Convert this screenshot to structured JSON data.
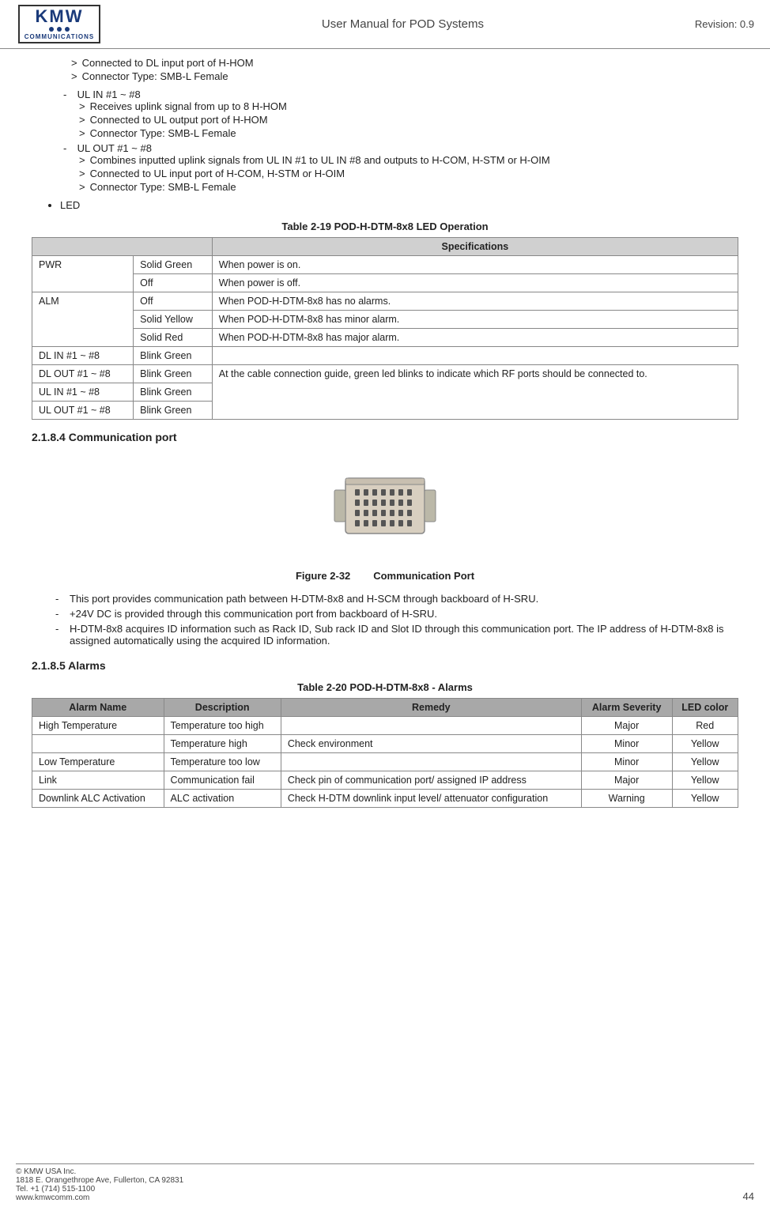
{
  "header": {
    "logo_letters": "KMW",
    "logo_comm": "COMMUNICATIONS",
    "title": "User Manual for POD Systems",
    "revision": "Revision: 0.9"
  },
  "bullets_top": {
    "items": [
      {
        "type": "sub",
        "text": "Connected to DL input port of H-HOM"
      },
      {
        "type": "sub",
        "text": "Connector Type: SMB-L Female"
      }
    ]
  },
  "dash_sections": [
    {
      "label": "UL IN #1 ~ #8",
      "subs": [
        "Receives uplink signal from up to 8 H-HOM",
        "Connected to UL output port of H-HOM",
        "Connector Type: SMB-L Female"
      ]
    },
    {
      "label": "UL OUT #1 ~ #8",
      "subs": [
        "Combines inputted uplink signals from UL IN #1 to UL IN #8 and outputs to H-COM, H-STM or H-OIM",
        "Connected to UL input port of H-COM, H-STM or H-OIM",
        "Connector Type: SMB-L Female"
      ]
    }
  ],
  "led_bullet": "LED",
  "table_led": {
    "title": "Table 2-19    POD-H-DTM-8x8 LED Operation",
    "col_header": "Specifications",
    "rows": [
      {
        "name": "PWR",
        "col2": "Solid Green",
        "col3": "When power is on."
      },
      {
        "name": "",
        "col2": "Off",
        "col3": "When power is off."
      },
      {
        "name": "ALM",
        "col2": "Off",
        "col3": "When POD-H-DTM-8x8 has no alarms."
      },
      {
        "name": "",
        "col2": "Solid Yellow",
        "col3": "When POD-H-DTM-8x8 has minor alarm."
      },
      {
        "name": "",
        "col2": "Solid Red",
        "col3": "When POD-H-DTM-8x8 has major alarm."
      },
      {
        "name": "DL IN #1 ~ #8",
        "col2": "Blink Green",
        "col3": ""
      },
      {
        "name": "DL OUT #1 ~ #8",
        "col2": "Blink Green",
        "col3": "At the cable connection guide, green led blinks to indicate which RF ports should be connected to."
      },
      {
        "name": "UL IN #1 ~ #8",
        "col2": "Blink Green",
        "col3": ""
      },
      {
        "name": "UL OUT #1 ~ #8",
        "col2": "Blink Green",
        "col3": ""
      }
    ]
  },
  "section_218_4": {
    "heading": "2.1.8.4   Communication port",
    "figure_num": "Figure 2-32",
    "figure_caption": "Communication Port",
    "body_items": [
      "This port provides communication path between H-DTM-8x8 and H-SCM through backboard of H-SRU.",
      "+24V DC is provided through this communication port from backboard of H-SRU.",
      "H-DTM-8x8 acquires ID information such as Rack ID, Sub rack ID and Slot ID through this communication port. The IP address of H-DTM-8x8 is assigned automatically using the acquired ID information."
    ]
  },
  "section_218_5": {
    "heading": "2.1.8.5   Alarms",
    "table_title": "Table 2-20    POD-H-DTM-8x8 - Alarms",
    "table_headers": [
      "Alarm Name",
      "Description",
      "Remedy",
      "Alarm Severity",
      "LED color"
    ],
    "table_rows": [
      {
        "alarm_name": "High Temperature",
        "description": "Temperature too high",
        "remedy": "",
        "severity": "Major",
        "led": "Red"
      },
      {
        "alarm_name": "",
        "description": "Temperature high",
        "remedy": "Check environment",
        "severity": "Minor",
        "led": "Yellow"
      },
      {
        "alarm_name": "Low Temperature",
        "description": "Temperature too low",
        "remedy": "",
        "severity": "Minor",
        "led": "Yellow"
      },
      {
        "alarm_name": "Link",
        "description": "Communication fail",
        "remedy": "Check pin of communication port/ assigned IP address",
        "severity": "Major",
        "led": "Yellow"
      },
      {
        "alarm_name": "Downlink ALC Activation",
        "description": "ALC activation",
        "remedy": "Check H-DTM downlink input level/ attenuator configuration",
        "severity": "Warning",
        "led": "Yellow"
      }
    ]
  },
  "footer": {
    "company": "© KMW USA Inc.",
    "address": "1818 E. Orangethrope Ave, Fullerton, CA 92831",
    "tel": "Tel. +1 (714) 515-1100",
    "web": "www.kmwcomm.com",
    "page": "44"
  }
}
